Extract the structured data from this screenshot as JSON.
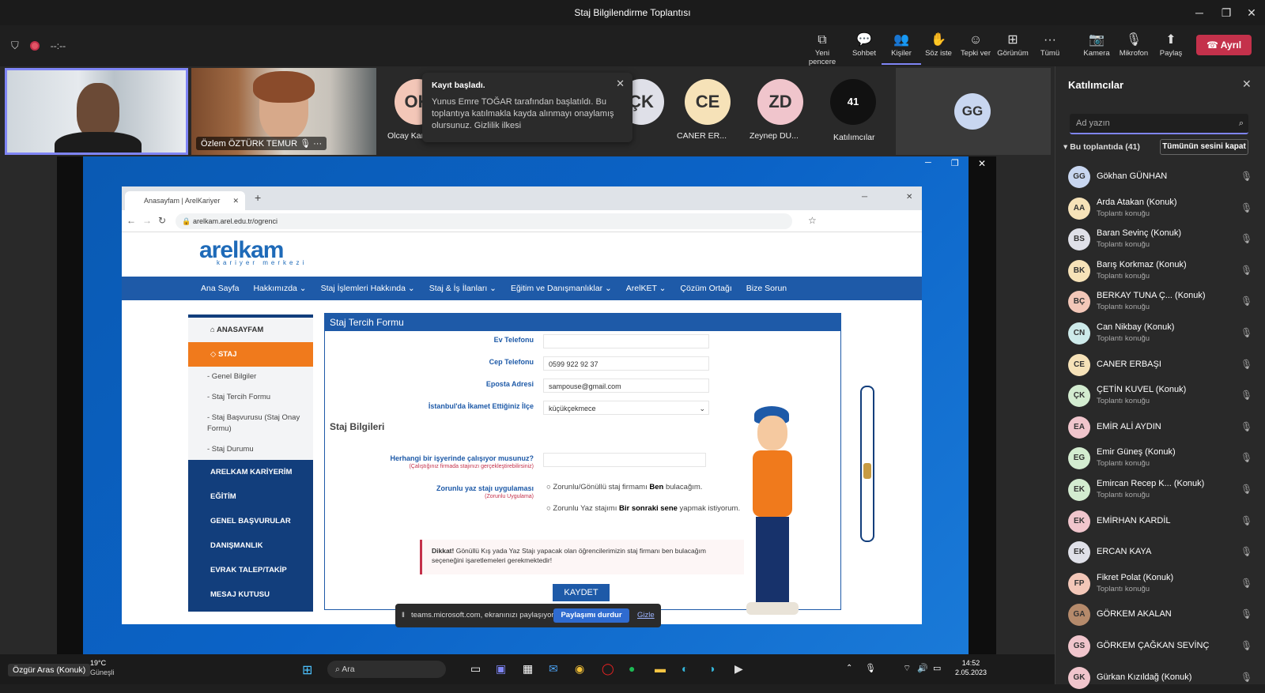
{
  "window": {
    "title": "Staj Bilgilendirme Toplantısı"
  },
  "toolbar": {
    "timer": "--:--",
    "buttons": [
      {
        "label": "Yeni pencere",
        "icon": "new-window-icon"
      },
      {
        "label": "Sohbet",
        "icon": "chat-icon"
      },
      {
        "label": "Kişiler",
        "icon": "people-icon"
      },
      {
        "label": "Söz iste",
        "icon": "raise-hand-icon"
      },
      {
        "label": "Tepki ver",
        "icon": "react-icon"
      },
      {
        "label": "Görünüm",
        "icon": "view-icon"
      },
      {
        "label": "Tümü",
        "icon": "more-icon"
      },
      {
        "label": "Kamera",
        "icon": "camera-off-icon"
      },
      {
        "label": "Mikrofon",
        "icon": "mic-off-icon"
      },
      {
        "label": "Paylaş",
        "icon": "share-icon"
      }
    ],
    "leave": "Ayrıl"
  },
  "stage": {
    "tile2_name": "Özlem ÖZTÜRK TEMUR",
    "avatars": [
      {
        "initials": "OK",
        "label": "Olcay Kara",
        "color": "#f3c7b8"
      },
      {
        "initials": "ÇK",
        "label": "Çetin ...",
        "color": "#dfe0e8"
      },
      {
        "initials": "CE",
        "label": "CANER ER...",
        "color": "#f6e2b8"
      },
      {
        "initials": "ZD",
        "label": "Zeynep DU...",
        "color": "#f0c5cc"
      }
    ],
    "more": {
      "count": "41",
      "label": "Katılımcılar"
    },
    "gg": "GG"
  },
  "toast": {
    "title": "Kayıt başladı.",
    "body": "Yunus Emre TOĞAR tarafından başlatıldı. Bu toplantıya katılmakla kayda alınmayı onaylamış olursunuz. Gizlilik ilkesi"
  },
  "browser": {
    "tab": "Anasayfam | ArelKariyer",
    "url": "arelkam.arel.edu.tr/ogrenci",
    "logo": "arelkam",
    "logo_sub": "kariyer merkezi",
    "nav": [
      "Ana Sayfa",
      "Hakkımızda ⌄",
      "Staj İşlemleri Hakkında ⌄",
      "Staj & İş İlanları ⌄",
      "Eğitim ve Danışmanlıklar ⌄",
      "ArelKET ⌄",
      "Çözüm Ortağı",
      "Bize Sorun"
    ],
    "side": {
      "home": "ANASAYFAM",
      "staj": "STAJ",
      "subs": [
        "- Genel Bilgiler",
        "- Staj Tercih Formu",
        "- Staj Başvurusu (Staj Onay Formu)",
        "- Staj Durumu"
      ],
      "items": [
        "ARELKAM KARİYERİM",
        "EĞİTİM",
        "GENEL BAŞVURULAR",
        "DANIŞMANLIK",
        "EVRAK TALEP/TAKİP",
        "MESAJ KUTUSU"
      ]
    },
    "form": {
      "title": "Staj Tercih Formu",
      "ev_label": "Ev Telefonu",
      "ev_value": "",
      "cep_label": "Cep Telefonu",
      "cep_value": "0599 922 92 37",
      "mail_label": "Eposta Adresi",
      "mail_value": "sampouse@gmail.com",
      "ilce_label": "İstanbul'da İkamet Ettiğiniz İlçe",
      "ilce_value": "küçükçekmece",
      "section": "Staj Bilgileri",
      "work_label": "Herhangi bir işyerinde çalışıyor musunuz?",
      "work_note": "(Çalıştığınız firmada stajınızı gerçekleştirebilirsiniz)",
      "zorunlu_label": "Zorunlu yaz stajı uygulaması",
      "zorunlu_note": "(Zorunlu Uygulama)",
      "opt1_a": "Zorunlu/Gönüllü staj firmamı ",
      "opt1_b": "Ben",
      "opt1_c": " bulacağım.",
      "opt2_a": "Zorunlu Yaz stajımı ",
      "opt2_b": "Bir sonraki sene",
      "opt2_c": " yapmak istiyorum.",
      "warn_b": "Dikkat!",
      "warn": " Gönüllü Kış yada Yaz Stajı yapacak olan öğrencilerimizin staj firmanı ben bulacağım seçeneğini işaretlemeleri gerekmektedir!",
      "save": "KAYDET"
    }
  },
  "sharebar": {
    "text": "teams.microsoft.com, ekranınızı paylaşıyor.",
    "stop": "Paylaşımı durdur",
    "hide": "Gizle"
  },
  "taskbar": {
    "user": "Özgür Aras (Konuk)",
    "temp": "19°C",
    "weather": "Güneşli",
    "search": "Ara",
    "time": "14:52",
    "date": "2.05.2023"
  },
  "panel": {
    "title": "Katılımcılar",
    "search_placeholder": "Ad yazın",
    "in_meeting": "Bu toplantıda (41)",
    "mute_all": "Tümünün sesini kapat",
    "people": [
      {
        "initials": "GG",
        "name": "Gökhan GÜNHAN",
        "role": "",
        "color": "#c8d6f0"
      },
      {
        "initials": "AA",
        "name": "Arda Atakan (Konuk)",
        "role": "Toplantı konuğu",
        "color": "#f6e2b8"
      },
      {
        "initials": "BS",
        "name": "Baran Sevinç (Konuk)",
        "role": "Toplantı konuğu",
        "color": "#dfe0e8"
      },
      {
        "initials": "BK",
        "name": "Barış Korkmaz (Konuk)",
        "role": "Toplantı konuğu",
        "color": "#f6e2b8"
      },
      {
        "initials": "BÇ",
        "name": "BERKAY TUNA Ç... (Konuk)",
        "role": "Toplantı konuğu",
        "color": "#f3c7b8"
      },
      {
        "initials": "CN",
        "name": "Can Nikbay (Konuk)",
        "role": "Toplantı konuğu",
        "color": "#cdeaea"
      },
      {
        "initials": "CE",
        "name": "CANER ERBAŞI",
        "role": "",
        "color": "#f6e2b8"
      },
      {
        "initials": "ÇK",
        "name": "ÇETİN KUVEL (Konuk)",
        "role": "Toplantı konuğu",
        "color": "#d3ecd0"
      },
      {
        "initials": "EA",
        "name": "EMİR ALİ AYDIN",
        "role": "",
        "color": "#f0c5cc"
      },
      {
        "initials": "EG",
        "name": "Emir Güneş (Konuk)",
        "role": "Toplantı konuğu",
        "color": "#d3ecd0"
      },
      {
        "initials": "EK",
        "name": "Emircan Recep K... (Konuk)",
        "role": "Toplantı konuğu",
        "color": "#d3ecd0"
      },
      {
        "initials": "EK",
        "name": "EMİRHAN KARDİL",
        "role": "",
        "color": "#f0c5cc"
      },
      {
        "initials": "EK",
        "name": "ERCAN KAYA",
        "role": "",
        "color": "#dfe0e8"
      },
      {
        "initials": "FP",
        "name": "Fikret Polat (Konuk)",
        "role": "Toplantı konuğu",
        "color": "#f3c7b8"
      },
      {
        "initials": "GA",
        "name": "GÖRKEM AKALAN",
        "role": "",
        "color": "#b58a6b"
      },
      {
        "initials": "GS",
        "name": "GÖRKEM ÇAĞKAN SEVİNÇ",
        "role": "",
        "color": "#f0c5cc"
      },
      {
        "initials": "GK",
        "name": "Gürkan Kızıldağ (Konuk)",
        "role": "",
        "color": "#f0c5cc"
      }
    ]
  }
}
